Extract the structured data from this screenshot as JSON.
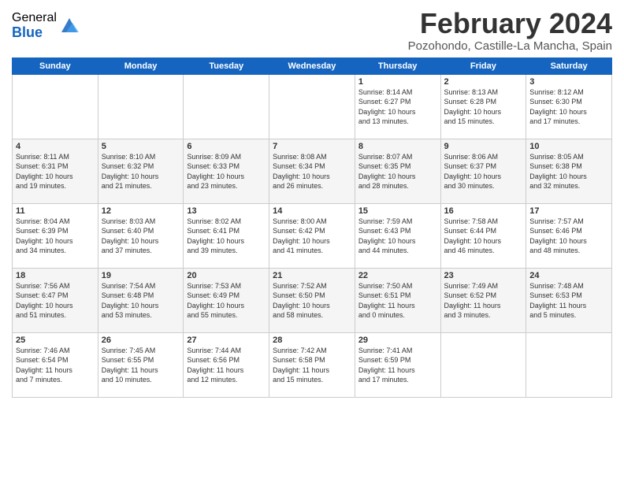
{
  "header": {
    "logo_general": "General",
    "logo_blue": "Blue",
    "month": "February 2024",
    "location": "Pozohondo, Castille-La Mancha, Spain"
  },
  "weekdays": [
    "Sunday",
    "Monday",
    "Tuesday",
    "Wednesday",
    "Thursday",
    "Friday",
    "Saturday"
  ],
  "weeks": [
    [
      {
        "day": "",
        "info": ""
      },
      {
        "day": "",
        "info": ""
      },
      {
        "day": "",
        "info": ""
      },
      {
        "day": "",
        "info": ""
      },
      {
        "day": "1",
        "info": "Sunrise: 8:14 AM\nSunset: 6:27 PM\nDaylight: 10 hours\nand 13 minutes."
      },
      {
        "day": "2",
        "info": "Sunrise: 8:13 AM\nSunset: 6:28 PM\nDaylight: 10 hours\nand 15 minutes."
      },
      {
        "day": "3",
        "info": "Sunrise: 8:12 AM\nSunset: 6:30 PM\nDaylight: 10 hours\nand 17 minutes."
      }
    ],
    [
      {
        "day": "4",
        "info": "Sunrise: 8:11 AM\nSunset: 6:31 PM\nDaylight: 10 hours\nand 19 minutes."
      },
      {
        "day": "5",
        "info": "Sunrise: 8:10 AM\nSunset: 6:32 PM\nDaylight: 10 hours\nand 21 minutes."
      },
      {
        "day": "6",
        "info": "Sunrise: 8:09 AM\nSunset: 6:33 PM\nDaylight: 10 hours\nand 23 minutes."
      },
      {
        "day": "7",
        "info": "Sunrise: 8:08 AM\nSunset: 6:34 PM\nDaylight: 10 hours\nand 26 minutes."
      },
      {
        "day": "8",
        "info": "Sunrise: 8:07 AM\nSunset: 6:35 PM\nDaylight: 10 hours\nand 28 minutes."
      },
      {
        "day": "9",
        "info": "Sunrise: 8:06 AM\nSunset: 6:37 PM\nDaylight: 10 hours\nand 30 minutes."
      },
      {
        "day": "10",
        "info": "Sunrise: 8:05 AM\nSunset: 6:38 PM\nDaylight: 10 hours\nand 32 minutes."
      }
    ],
    [
      {
        "day": "11",
        "info": "Sunrise: 8:04 AM\nSunset: 6:39 PM\nDaylight: 10 hours\nand 34 minutes."
      },
      {
        "day": "12",
        "info": "Sunrise: 8:03 AM\nSunset: 6:40 PM\nDaylight: 10 hours\nand 37 minutes."
      },
      {
        "day": "13",
        "info": "Sunrise: 8:02 AM\nSunset: 6:41 PM\nDaylight: 10 hours\nand 39 minutes."
      },
      {
        "day": "14",
        "info": "Sunrise: 8:00 AM\nSunset: 6:42 PM\nDaylight: 10 hours\nand 41 minutes."
      },
      {
        "day": "15",
        "info": "Sunrise: 7:59 AM\nSunset: 6:43 PM\nDaylight: 10 hours\nand 44 minutes."
      },
      {
        "day": "16",
        "info": "Sunrise: 7:58 AM\nSunset: 6:44 PM\nDaylight: 10 hours\nand 46 minutes."
      },
      {
        "day": "17",
        "info": "Sunrise: 7:57 AM\nSunset: 6:46 PM\nDaylight: 10 hours\nand 48 minutes."
      }
    ],
    [
      {
        "day": "18",
        "info": "Sunrise: 7:56 AM\nSunset: 6:47 PM\nDaylight: 10 hours\nand 51 minutes."
      },
      {
        "day": "19",
        "info": "Sunrise: 7:54 AM\nSunset: 6:48 PM\nDaylight: 10 hours\nand 53 minutes."
      },
      {
        "day": "20",
        "info": "Sunrise: 7:53 AM\nSunset: 6:49 PM\nDaylight: 10 hours\nand 55 minutes."
      },
      {
        "day": "21",
        "info": "Sunrise: 7:52 AM\nSunset: 6:50 PM\nDaylight: 10 hours\nand 58 minutes."
      },
      {
        "day": "22",
        "info": "Sunrise: 7:50 AM\nSunset: 6:51 PM\nDaylight: 11 hours\nand 0 minutes."
      },
      {
        "day": "23",
        "info": "Sunrise: 7:49 AM\nSunset: 6:52 PM\nDaylight: 11 hours\nand 3 minutes."
      },
      {
        "day": "24",
        "info": "Sunrise: 7:48 AM\nSunset: 6:53 PM\nDaylight: 11 hours\nand 5 minutes."
      }
    ],
    [
      {
        "day": "25",
        "info": "Sunrise: 7:46 AM\nSunset: 6:54 PM\nDaylight: 11 hours\nand 7 minutes."
      },
      {
        "day": "26",
        "info": "Sunrise: 7:45 AM\nSunset: 6:55 PM\nDaylight: 11 hours\nand 10 minutes."
      },
      {
        "day": "27",
        "info": "Sunrise: 7:44 AM\nSunset: 6:56 PM\nDaylight: 11 hours\nand 12 minutes."
      },
      {
        "day": "28",
        "info": "Sunrise: 7:42 AM\nSunset: 6:58 PM\nDaylight: 11 hours\nand 15 minutes."
      },
      {
        "day": "29",
        "info": "Sunrise: 7:41 AM\nSunset: 6:59 PM\nDaylight: 11 hours\nand 17 minutes."
      },
      {
        "day": "",
        "info": ""
      },
      {
        "day": "",
        "info": ""
      }
    ]
  ]
}
